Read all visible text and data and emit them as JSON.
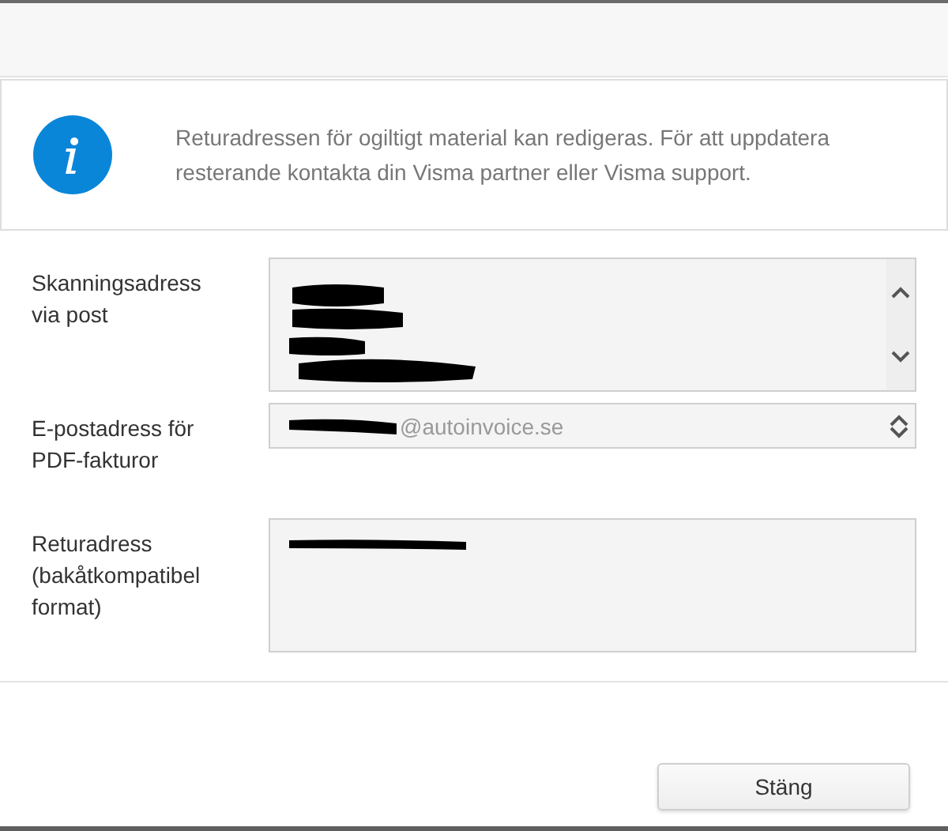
{
  "info": {
    "message": "Returadressen för ogiltigt material kan redigeras. För att uppdatera resterande kontakta din Visma partner eller Visma support."
  },
  "fields": [
    {
      "kind": "scroll",
      "label": "Skanningsadress via post",
      "redacted": true
    },
    {
      "kind": "spinner",
      "label": "E-postadress för PDF-fakturor",
      "value": "@autoinvoice.se",
      "redacted": true
    },
    {
      "kind": "area",
      "label": "Returadress (bakåtkompatibel format)",
      "redacted": true
    }
  ],
  "buttons": [
    {
      "label": "Stäng"
    }
  ]
}
